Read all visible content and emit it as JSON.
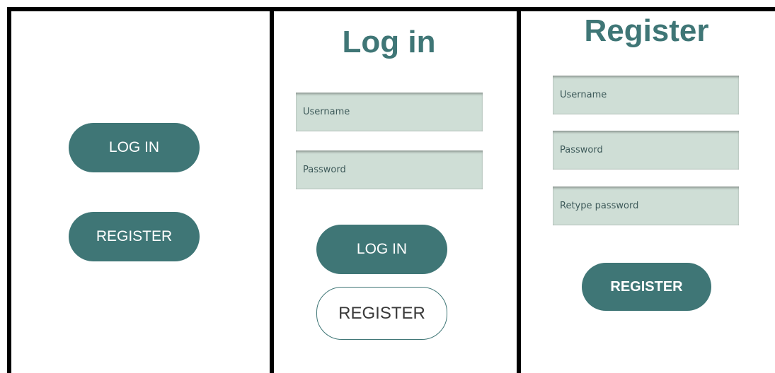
{
  "welcome": {
    "login_label": "LOG IN",
    "register_label": "REGISTER"
  },
  "login": {
    "title": "Log in",
    "username_placeholder": "Username",
    "password_placeholder": "Password",
    "login_label": "LOG IN",
    "register_label": "REGISTER"
  },
  "register": {
    "title": "Register",
    "username_placeholder": "Username",
    "password_placeholder": "Password",
    "retype_placeholder": "Retype password",
    "register_label": "REGISTER"
  },
  "colors": {
    "accent": "#3f7676",
    "field": "#cfded6",
    "border": "#000000"
  }
}
